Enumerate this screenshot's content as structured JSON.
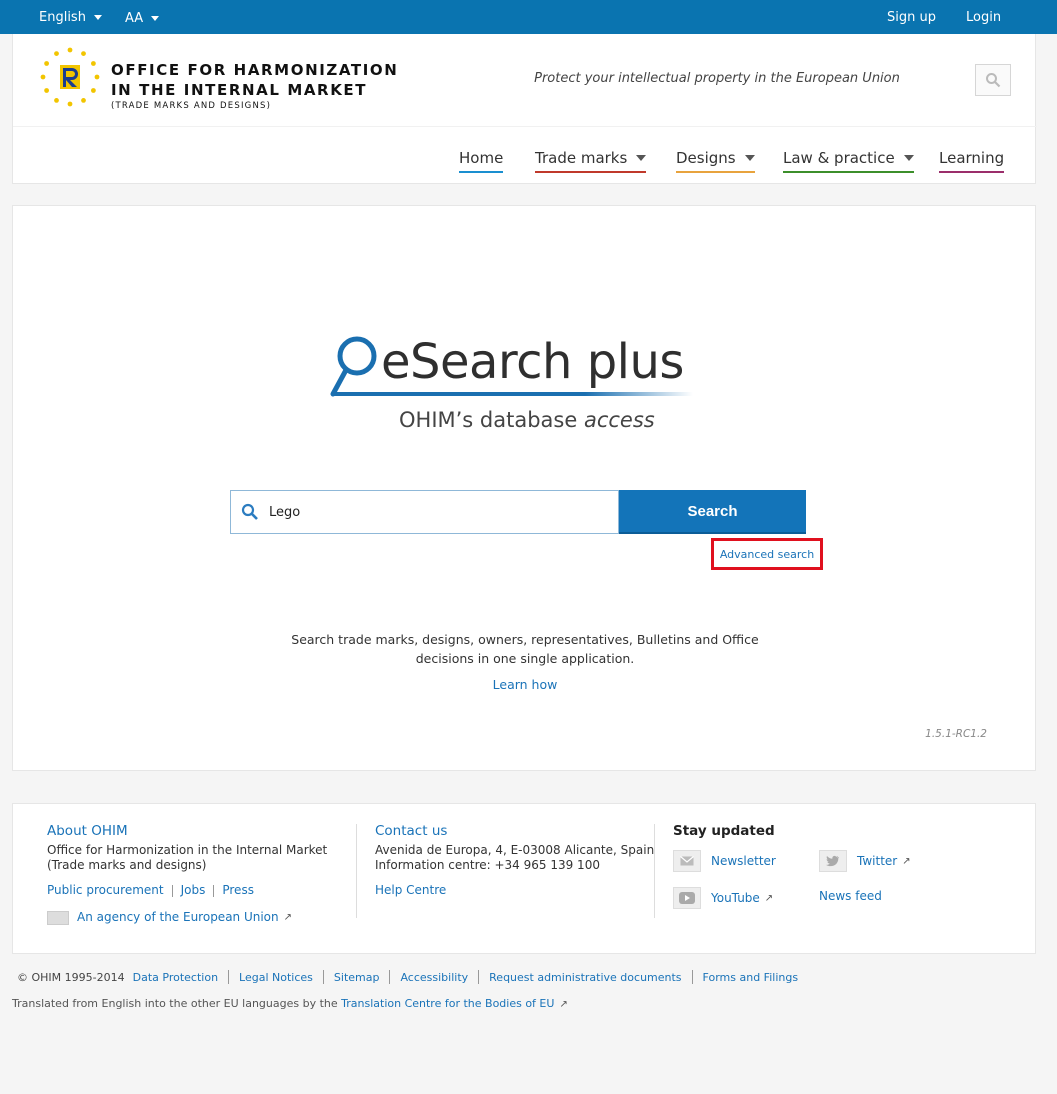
{
  "topbar": {
    "language": "English",
    "font_size": "AA",
    "signup": "Sign up",
    "login": "Login"
  },
  "header": {
    "org_line1": "OFFICE FOR HARMONIZATION",
    "org_line2": "IN THE INTERNAL MARKET",
    "org_line3": "(TRADE MARKS AND DESIGNS)",
    "tagline": "Protect your intellectual property in the European Union",
    "nav": [
      {
        "label": "Home",
        "color": "#1a8fd0"
      },
      {
        "label": "Trade marks",
        "color": "#c0392b"
      },
      {
        "label": "Designs",
        "color": "#e8a33d"
      },
      {
        "label": "Law & practice",
        "color": "#3c8f2b"
      },
      {
        "label": "Learning",
        "color": "#9b2e6b"
      }
    ]
  },
  "main": {
    "brand_title": "eSearch plus",
    "brand_sub_prefix": "OHIM’s database ",
    "brand_sub_italic": "access",
    "search_value": "Lego",
    "search_button": "Search",
    "advanced_search": "Advanced search",
    "description_line1": "Search trade marks, designs, owners, representatives, Bulletins and Office",
    "description_line2": "decisions in one single application.",
    "learn_how": "Learn how",
    "version": "1.5.1-RC1.2"
  },
  "footer": {
    "about": {
      "title": "About OHIM",
      "line1": "Office for Harmonization in the Internal Market",
      "line2": "(Trade marks and designs)",
      "link1": "Public procurement",
      "link2": "Jobs",
      "link3": "Press",
      "agency": "An agency of the European Union"
    },
    "contact": {
      "title": "Contact us",
      "address": "Avenida de Europa, 4, E-03008 Alicante, Spain",
      "phone": "Information centre: +34 965 139 100",
      "help": "Help Centre"
    },
    "stay": {
      "title": "Stay updated",
      "newsletter": "Newsletter",
      "twitter": "Twitter",
      "youtube": "YouTube",
      "newsfeed": "News feed"
    }
  },
  "legal": {
    "copyright": "© OHIM 1995-2014",
    "links": [
      "Data Protection",
      "Legal Notices",
      "Sitemap",
      "Accessibility",
      "Request administrative documents",
      "Forms and Filings"
    ],
    "translated_prefix": "Translated from English into the other EU languages by the ",
    "translated_link": "Translation Centre for the Bodies of EU"
  }
}
